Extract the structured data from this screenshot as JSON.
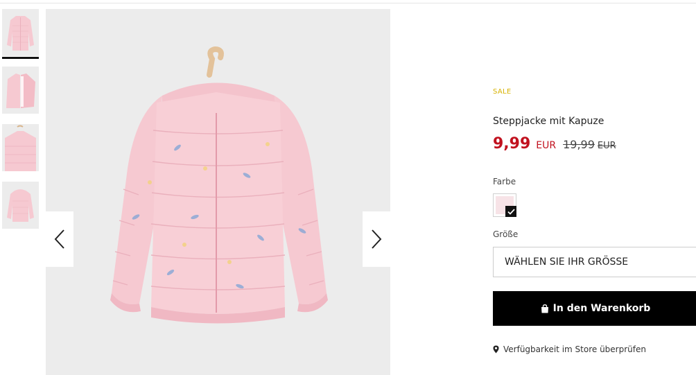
{
  "gallery": {
    "thumbnails": [
      {
        "alt": "jacket-front"
      },
      {
        "alt": "jacket-open"
      },
      {
        "alt": "jacket-detail"
      },
      {
        "alt": "jacket-back"
      }
    ],
    "active_index": 0,
    "prev_icon": "chevron-left-icon",
    "next_icon": "chevron-right-icon"
  },
  "product": {
    "badge": "SALE",
    "title": "Steppjacke mit Kapuze",
    "price_current": "9,99",
    "price_current_currency": "EUR",
    "price_old": "19,99",
    "price_old_currency": "EUR"
  },
  "color": {
    "label": "Farbe"
  },
  "size": {
    "label": "Größe",
    "placeholder": "WÄHLEN SIE IHR GRÖSSE"
  },
  "cart": {
    "label": "In den Warenkorb",
    "icon": "shopping-bag-icon"
  },
  "store": {
    "label": "Verfügbarkeit im Store überprüfen",
    "icon": "map-pin-icon"
  },
  "colors": {
    "sale": "#d7b200",
    "price": "#c1121f",
    "button": "#000000",
    "jacket": "#f6c9d1"
  }
}
